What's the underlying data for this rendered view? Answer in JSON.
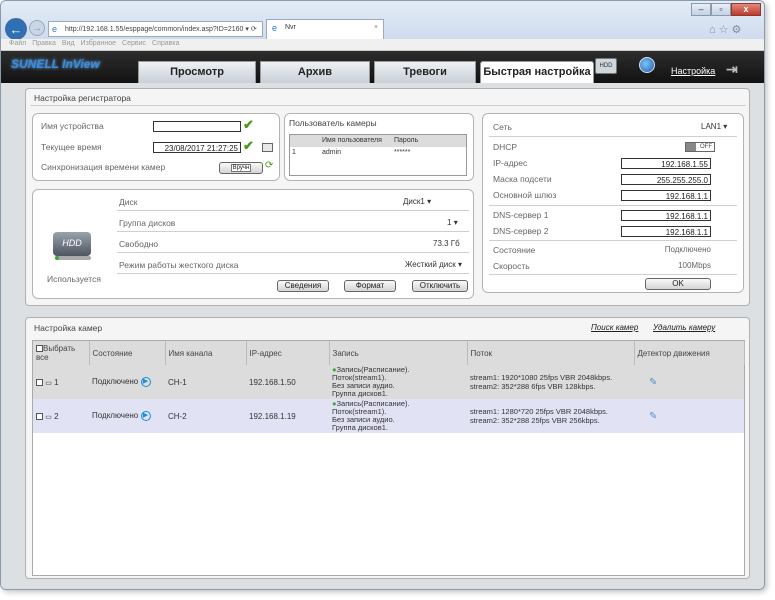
{
  "browser": {
    "url": "http://192.168.1.55/esppage/common/index.asp?ID=2160 ▾ ⟳",
    "tab_title": "Nvr",
    "menu": [
      "Файл",
      "Правка",
      "Вид",
      "Избранное",
      "Сервис",
      "Справка"
    ],
    "window_controls": [
      "–",
      "▫",
      "x"
    ]
  },
  "app": {
    "logo": "SUNELL InView",
    "nav_tabs": [
      "Просмотр",
      "Архив",
      "Тревоги",
      "Быстрая настройка"
    ],
    "settings_link": "Настройка",
    "hdd_label": "HDD"
  },
  "recorder": {
    "title": "Настройка регистратора",
    "device_name_label": "Имя устройства",
    "device_name_value": "",
    "current_time_label": "Текущее время",
    "current_time_value": "23/08/2017 21:27:25",
    "sync_label": "Синхронизация времени камер",
    "sync_btn": "Вручн",
    "camera_user_title": "Пользователь камеры",
    "user_table": {
      "headers": [
        "Имя пользователя",
        "Пароль"
      ],
      "rows": [
        [
          "1",
          "admin",
          "******"
        ]
      ]
    }
  },
  "disk": {
    "label": "Диск",
    "value": "Диск1",
    "group_label": "Группа дисков",
    "group_value": "1",
    "free_label": "Свободно",
    "free_value": "73.3 Гб",
    "mode_label": "Режим работы жесткого диска",
    "mode_value": "Жесткий диск",
    "hdd_icon_text": "HDD",
    "used_label": "Используется",
    "buttons": [
      "Сведения",
      "Формат",
      "Отключить"
    ]
  },
  "network": {
    "label": "Сеть",
    "value": "LAN1",
    "dhcp_label": "DHCP",
    "dhcp_state": "OFF",
    "ip_label": "IP-адрес",
    "ip_value": "192.168.1.55",
    "mask_label": "Маска подсети",
    "mask_value": "255.255.255.0",
    "gw_label": "Основной шлюз",
    "gw_value": "192.168.1.1",
    "dns1_label": "DNS-сервер 1",
    "dns1_value": "192.168.1.1",
    "dns2_label": "DNS-сервер 2",
    "dns2_value": "192.168.1.1",
    "status_label": "Состояние",
    "status_value": "Подключено",
    "speed_label": "Скорость",
    "speed_value": "100Mbps",
    "ok_btn": "OK"
  },
  "cameras": {
    "title": "Настройка камер",
    "search_link": "Поиск камер",
    "delete_link": "Удалить камеру",
    "headers": [
      "Выбрать все",
      "Состояние",
      "Имя канала",
      "IP-адрес",
      "Запись",
      "Поток",
      "Детектор движения"
    ],
    "rows": [
      {
        "num": "1",
        "status": "Подключено",
        "channel": "CH-1",
        "ip": "192.168.1.50",
        "rec": [
          "Запись(Расписание).",
          "Поток(stream1).",
          "Без записи аудио.",
          "Группа дисков1."
        ],
        "stream": [
          "stream1: 1920*1080 25fps VBR 2048kbps.",
          "stream2: 352*288 6fps VBR 128kbps."
        ]
      },
      {
        "num": "2",
        "status": "Подключено",
        "channel": "CH-2",
        "ip": "192.168.1.19",
        "rec": [
          "Запись(Расписание).",
          "Поток(stream1).",
          "Без записи аудио.",
          "Группа дисков1."
        ],
        "stream": [
          "stream1: 1280*720 25fps VBR 2048kbps.",
          "stream2: 352*288 25fps VBR 256kbps."
        ]
      }
    ]
  }
}
